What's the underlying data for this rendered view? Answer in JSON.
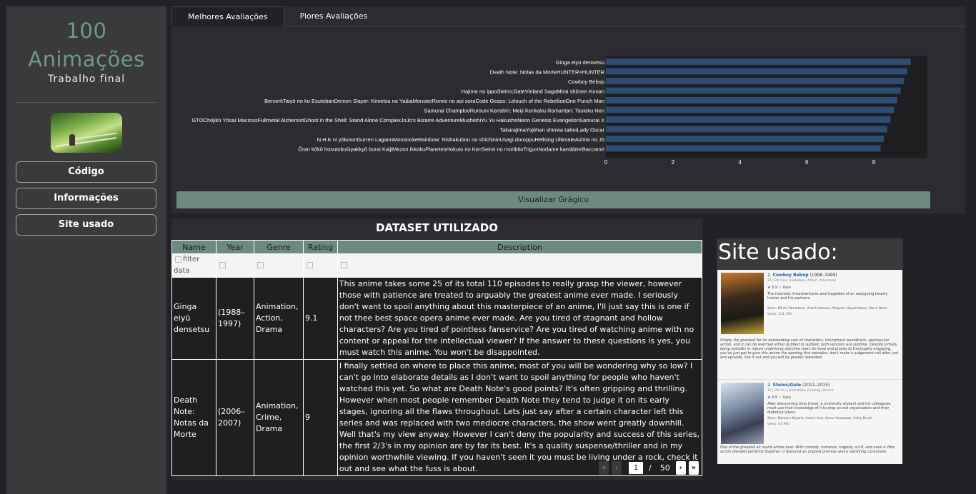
{
  "sidebar": {
    "title_line1": "100",
    "title_line2": "Animações",
    "subtitle": "Trabalho final",
    "nav": [
      "Código",
      "Informações",
      "Site usado"
    ]
  },
  "tabs": [
    "Melhores Avaliações",
    "Piores Avaliações"
  ],
  "viz_button": "Visualizar Grágico",
  "chart_data": {
    "type": "bar",
    "orientation": "horizontal",
    "categories": [
      "Ginga eiyū densetsu",
      "Death Note: Notas da MorteHUNTER×HUNTER",
      "Cowboy Bebop",
      "Hajime no ippoSteins;GateVinland SagaMirai shōnen Konan",
      "BerserkTaiyō no ko EsutebanDemon Slayer: Kimetsu no YaibaMonsterRomio no aoi soraCode Geass: Lelouch of the RebellionOne Punch Man",
      "Samurai ChamplooRurouni Kenshin: Meiji Kenkaku Romantan: Tsuioku Hen",
      "GTOChōjikū Yōsai MacrossFullmetal AlchemistGhost in the Shell: Stand Alone ComplexJoJo's Bizarre AdventureMushishiYu Yu HakushoNeon Genesis EvangelionSamurai X",
      "TakarajimaYojōhan shinwa taikeiLady Oscar",
      "N.H.K ni yōkoso!Gurren LagannMononokeRainbow: Nishakubou no shichininUsagi doroppuHellsing UltimateAshita no Jō",
      "Ōran kōkō hosutobuGyakkyō burai KaijiMezon IkkokuPlanetesHokuto no KenSeirei no moribitoTrigunNodame kantābireBaccano!"
    ],
    "values": [
      9.1,
      9.0,
      8.9,
      8.8,
      8.7,
      8.6,
      8.5,
      8.4,
      8.3,
      8.2
    ],
    "xticks": [
      "0",
      "2",
      "4",
      "6",
      "8"
    ],
    "xlim": [
      0,
      9.6
    ],
    "bar_color": "#2e4d74",
    "plot_background": "#1e1e21"
  },
  "dataset": {
    "title": "DATASET UTILIZADO",
    "columns": [
      "Name",
      "Year",
      "Genre",
      "Rating",
      "Description"
    ],
    "filter_placeholder": "filter data",
    "rows": [
      {
        "name": "Ginga eiyū densetsu",
        "year": "(1988–1997)",
        "genre": "Animation, Action, Drama",
        "rating": "9.1",
        "description": "This anime takes some 25 of its total 110 episodes to really grasp the viewer, however those with patience are treated to arguably the greatest anime ever made. I seriously don't want to spoil anything about this masterpiece of an anime, I'll just say this is one if not thee best space opera anime ever made. Are you tired of stagnant and hollow characters? Are you tired of pointless fanservice? Are you tired of watching anime with no content or appeal for the intellectual viewer? If the answer to these questions is yes, you must watch this anime. You won't be disappointed."
      },
      {
        "name": "Death Note: Notas da Morte",
        "year": "(2006–2007)",
        "genre": "Animation, Crime, Drama",
        "rating": "9",
        "description": "I finally settled on where to place this anime, most of you will be wondering why so low? I can't go into elaborate details as I don't want to spoil anything for people who haven't watched this yet. So what are Death Note's good points? It's often gripping and thrilling. However when most people remember Death Note they tend to judge it on its early stages, ignoring all the flaws throughout. Lets just say after a certain character left this series and was replaced with two mediocre characters, the show went greatly downhill. Well that's my view anyway. However I can't deny the popularity and success of this series, the first 2/3's in my opinion are by far its best. It's a quality suspense/thriller and in my opinion worthwhile viewing. If you haven't seen it you must be living under a rock, check it out and see what the fuss is about."
      }
    ],
    "pager": {
      "first": "«",
      "prev": "‹",
      "current": "1",
      "sep": "/",
      "total": "50",
      "next": "›",
      "last": "»"
    }
  },
  "site": {
    "title": "Site usado:",
    "entries": [
      {
        "index": "1.",
        "title": "Cowboy Bebop",
        "years": "(1998–1999)",
        "meta": "26 | 24 min | Animation, Action, Adventure",
        "rating": "★ 8.9",
        "rate": "☆ Rate",
        "desc": "The futuristic misadventures and tragedies of an easygoing bounty hunter and his partners.",
        "stars": "Stars: Kōichi Yamadera, Unshō Ishizuka, Megumi Hayashibara, Steve Blum",
        "votes": "Votes: 121,786",
        "review": "Simply the greatest for an outstanding cast of characters, triumphant soundtrack, spectacular action, and it can be watched either dubbed or subbed, both versions are sublime. Despite initially being episodic in nature underlying storyline rears its head and proves to thoroughly engaging, you've just got to give this anime the opening five episodes, don't make a judgement call after just one episode. See it out and you will be greatly rewarded."
      },
      {
        "index": "2.",
        "title": "Steins;Gate",
        "years": "(2011–2015)",
        "meta": "12 | 24 min | Animation, Comedy, Drama",
        "rating": "★ 8.8",
        "rate": "☆ Rate",
        "desc": "After discovering time travel, a university student and his colleagues must use their knowledge of it to stop an evil organization and their diabolical plans.",
        "stars": "Stars: Mamoru Miyano, Asami Imai, Kana Hanazawa, Ashly Burch",
        "votes": "Votes: 63,990",
        "review": "One of the greatest all round anime ever. With comedy, romance, tragedy, sci-fi, and even a little action blended perfectly together. It featured an original premise and a satisfying conclusion."
      }
    ]
  }
}
